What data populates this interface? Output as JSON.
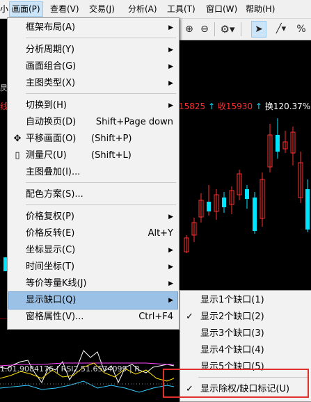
{
  "menubar": {
    "items": [
      "画面(P)",
      "查看(V)",
      "交易(J)",
      "分析(A)",
      "工具(T)",
      "窗口(W)",
      "帮助(H)"
    ]
  },
  "chart_header": {
    "left_clip": "线",
    "left_clip_top": "昃",
    "quote_prefix": "15825",
    "quote_receive": "收15930",
    "quote_turnover": "换120.37%",
    "indicator_text": "1.01.9084176 | RSI2.51.6574099 | R",
    "side_tick": "-"
  },
  "main_menu": {
    "items": [
      {
        "label": "框架布局(A)",
        "shortcut": "",
        "submenu": true
      },
      {
        "label": "分析周期(Y)",
        "shortcut": "",
        "submenu": true
      },
      {
        "label": "画面组合(G)",
        "shortcut": "",
        "submenu": true
      },
      {
        "label": "主图类型(X)",
        "shortcut": "",
        "submenu": true
      },
      {
        "label": "切换到(H)",
        "shortcut": "",
        "submenu": true
      },
      {
        "label": "自动换页(D)",
        "shortcut": "Shift+Page down",
        "submenu": false
      },
      {
        "label": "平移画面(O)",
        "shortcut": "(Shift+P)",
        "submenu": false,
        "icon": "move-icon"
      },
      {
        "label": "测量尺(U)",
        "shortcut": "(Shift+L)",
        "submenu": false,
        "icon": "ruler-icon"
      },
      {
        "label": "主图叠加(I)...",
        "shortcut": "",
        "submenu": false
      },
      {
        "label": "配色方案(S)...",
        "shortcut": "",
        "submenu": false
      },
      {
        "label": "价格复权(P)",
        "shortcut": "",
        "submenu": true
      },
      {
        "label": "价格反转(E)",
        "shortcut": "Alt+Y",
        "submenu": false
      },
      {
        "label": "坐标显示(C)",
        "shortcut": "",
        "submenu": true
      },
      {
        "label": "时间坐标(T)",
        "shortcut": "",
        "submenu": true
      },
      {
        "label": "等价等量K线(J)",
        "shortcut": "",
        "submenu": true
      },
      {
        "label": "显示缺口(Q)",
        "shortcut": "",
        "submenu": true
      },
      {
        "label": "窗格属性(V)...",
        "shortcut": "Ctrl+F4",
        "submenu": false
      }
    ]
  },
  "gap_submenu": {
    "items": [
      {
        "label": "显示1个缺口(1)",
        "checked": false
      },
      {
        "label": "显示2个缺口(2)",
        "checked": true
      },
      {
        "label": "显示3个缺口(3)",
        "checked": false
      },
      {
        "label": "显示4个缺口(4)",
        "checked": false
      },
      {
        "label": "显示5个缺口(5)",
        "checked": false
      },
      {
        "label": "显示除权/缺口标记(U)",
        "checked": true
      }
    ]
  },
  "colors": {
    "up_candle": "#ff3030",
    "down_candle": "#00e5ff",
    "menu_highlight": "#9bc2e6",
    "annotation_box": "#e0302a"
  }
}
